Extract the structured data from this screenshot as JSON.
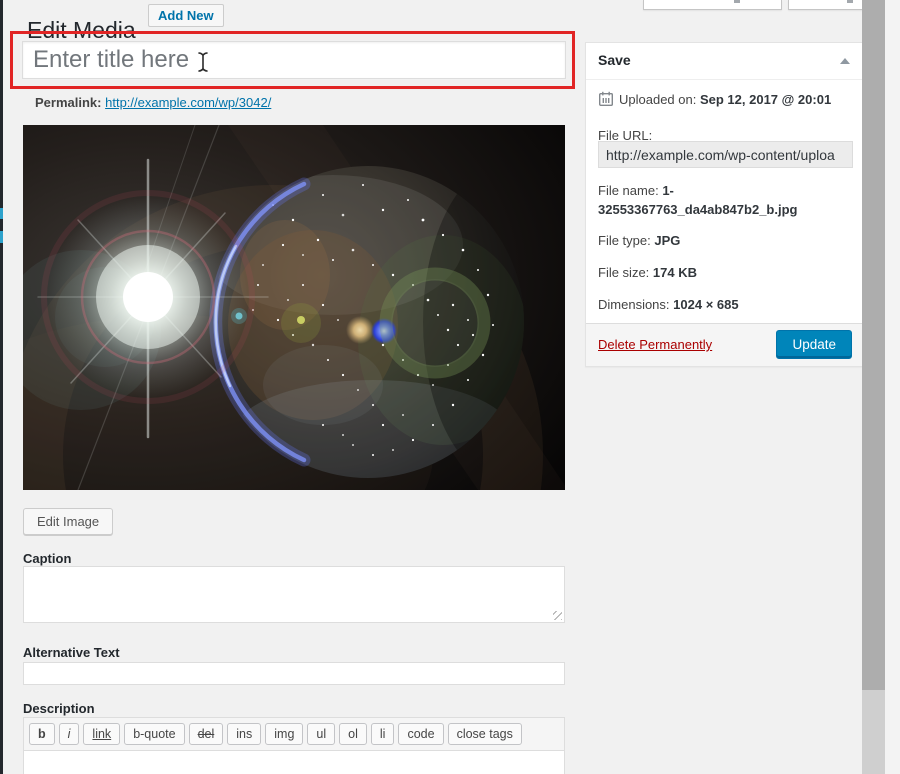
{
  "header": {
    "title": "Edit Media",
    "add_new_label": "Add New"
  },
  "title_field": {
    "placeholder": "Enter title here",
    "value": ""
  },
  "permalink": {
    "label": "Permalink:",
    "url": "http://example.com/wp/3042/"
  },
  "media": {
    "edit_image_label": "Edit Image"
  },
  "caption": {
    "label": "Caption",
    "value": ""
  },
  "alt_text": {
    "label": "Alternative Text",
    "value": ""
  },
  "editor": {
    "label": "Description",
    "value": "",
    "toolbar": [
      {
        "label": "b"
      },
      {
        "label": "i"
      },
      {
        "label": "link"
      },
      {
        "label": "b-quote"
      },
      {
        "label": "del"
      },
      {
        "label": "ins"
      },
      {
        "label": "img"
      },
      {
        "label": "ul"
      },
      {
        "label": "ol"
      },
      {
        "label": "li"
      },
      {
        "label": "code"
      },
      {
        "label": "close tags"
      }
    ]
  },
  "save_panel": {
    "title": "Save",
    "uploaded_label": "Uploaded on:",
    "uploaded_value": "Sep 12, 2017 @ 20:01",
    "file_url_label": "File URL:",
    "file_url_value": "http://example.com/wp-content/uploa",
    "file_name_label": "File name:",
    "file_name_value": "1-32553367763_da4ab847b2_b.jpg",
    "file_type_label": "File type:",
    "file_type_value": "JPG",
    "file_size_label": "File size:",
    "file_size_value": "174 KB",
    "dimensions_label": "Dimensions:",
    "dimensions_value": "1024 × 685",
    "delete_label": "Delete Permanently",
    "update_label": "Update"
  },
  "colors": {
    "accent": "#0073aa",
    "primary_button": "#0085ba",
    "delete_red": "#a00000",
    "annotation": "#e12525",
    "admin_bar": "#23282d"
  }
}
